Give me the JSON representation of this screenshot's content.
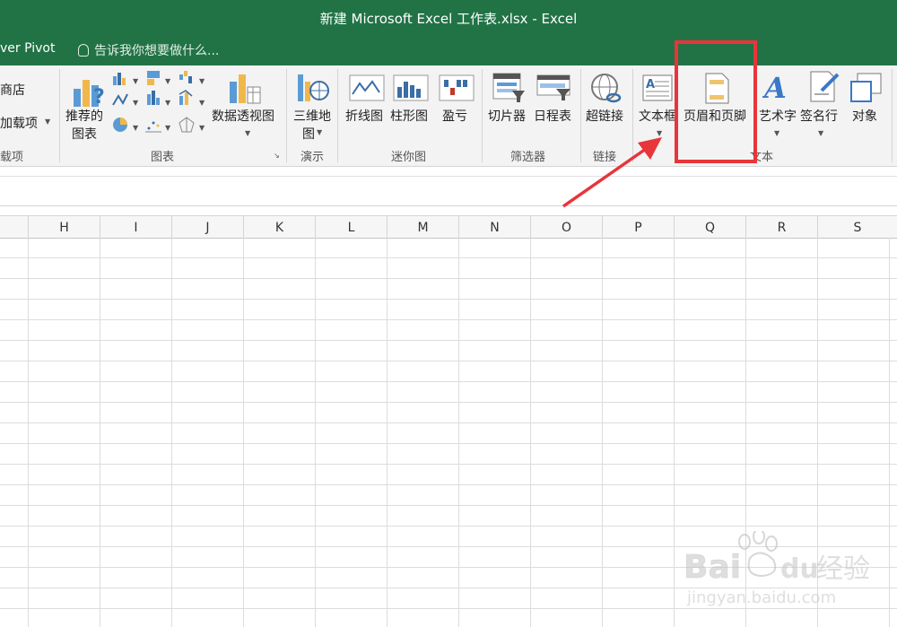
{
  "window": {
    "title": "新建 Microsoft Excel 工作表.xlsx - Excel"
  },
  "tabs": {
    "power_pivot": "ver Pivot",
    "tell_me": "告诉我你想要做什么..."
  },
  "ribbon": {
    "store": "商店",
    "addins": "加载项",
    "addins_group": "载项",
    "recommended_charts_1": "推荐的",
    "recommended_charts_2": "图表",
    "pivot_chart": "数据透视图",
    "charts_group": "图表",
    "map_3d_1": "三维地",
    "map_3d_2": "图",
    "tours_group": "演示",
    "line_spark": "折线图",
    "column_spark": "柱形图",
    "winloss_spark": "盈亏",
    "sparklines_group": "迷你图",
    "slicer": "切片器",
    "timeline": "日程表",
    "filters_group": "筛选器",
    "hyperlink": "超链接",
    "links_group": "链接",
    "textbox": "文本框",
    "header_footer": "页眉和页脚",
    "wordart": "艺术字",
    "signature_line": "签名行",
    "object": "对象",
    "text_group": "文本"
  },
  "columns": [
    "H",
    "I",
    "J",
    "K",
    "L",
    "M",
    "N",
    "O",
    "P",
    "Q",
    "R",
    "S"
  ],
  "watermark": {
    "brand": "Bai",
    "brand2": "du",
    "product": "经验",
    "url": "jingyan.baidu.com"
  },
  "colors": {
    "excel_green": "#217346",
    "highlight_red": "#e8353a",
    "arrow_red": "#e8353a"
  }
}
